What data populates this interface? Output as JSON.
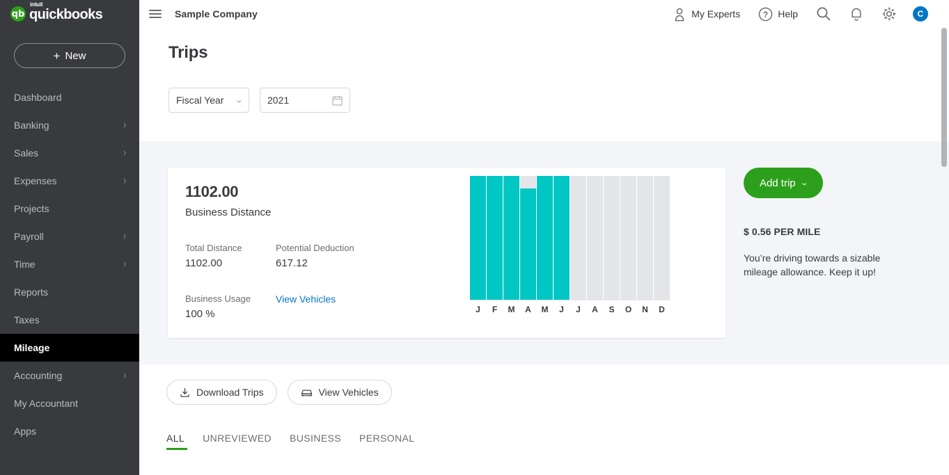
{
  "brand": {
    "intuit": "intuit",
    "name": "quickbooks",
    "mark": "qb",
    "green": "#2ca01c",
    "teal": "#00c7c4",
    "link_blue": "#0077c5"
  },
  "sidebar": {
    "new_button": "New",
    "new_plus": "+",
    "items": [
      {
        "label": "Dashboard",
        "expandable": false,
        "active": false
      },
      {
        "label": "Banking",
        "expandable": true,
        "active": false
      },
      {
        "label": "Sales",
        "expandable": true,
        "active": false
      },
      {
        "label": "Expenses",
        "expandable": true,
        "active": false
      },
      {
        "label": "Projects",
        "expandable": false,
        "active": false
      },
      {
        "label": "Payroll",
        "expandable": true,
        "active": false
      },
      {
        "label": "Time",
        "expandable": true,
        "active": false
      },
      {
        "label": "Reports",
        "expandable": false,
        "active": false
      },
      {
        "label": "Taxes",
        "expandable": false,
        "active": false
      },
      {
        "label": "Mileage",
        "expandable": false,
        "active": true
      },
      {
        "label": "Accounting",
        "expandable": true,
        "active": false
      },
      {
        "label": "My Accountant",
        "expandable": false,
        "active": false
      },
      {
        "label": "Apps",
        "expandable": false,
        "active": false
      }
    ]
  },
  "topbar": {
    "menu_icon": "hamburger-icon",
    "company": "Sample Company",
    "my_experts": "My Experts",
    "my_experts_icon": "person-icon",
    "help": "Help",
    "help_icon": "question-circle-icon",
    "search_icon": "search-icon",
    "notifications_icon": "bell-icon",
    "settings_icon": "gear-icon",
    "avatar_initial": "C"
  },
  "page": {
    "title": "Trips"
  },
  "filters": {
    "period": "Fiscal Year",
    "period_caret": "chevron-down-icon",
    "year": "2021",
    "year_icon": "calendar-icon"
  },
  "summary": {
    "headline_value": "1102.00",
    "headline_label": "Business Distance",
    "total_distance_label": "Total Distance",
    "total_distance_value": "1102.00",
    "potential_deduction_label": "Potential Deduction",
    "potential_deduction_value": "617.12",
    "business_usage_label": "Business Usage",
    "business_usage_value": "100 %",
    "view_vehicles_link": "View Vehicles"
  },
  "right_pane": {
    "add_trip": "Add trip",
    "add_trip_caret": "chevron-down-icon",
    "rate": "$ 0.56 PER MILE",
    "blurb": "You’re driving towards a sizable mileage allowance. Keep it up!"
  },
  "actions": {
    "download_trips": "Download Trips",
    "download_icon": "download-icon",
    "view_vehicles": "View Vehicles",
    "vehicle_icon": "car-icon"
  },
  "tabs": [
    {
      "label": "ALL",
      "active": true
    },
    {
      "label": "UNREVIEWED",
      "active": false
    },
    {
      "label": "BUSINESS",
      "active": false
    },
    {
      "label": "PERSONAL",
      "active": false
    }
  ],
  "chart_data": {
    "type": "bar",
    "title": "",
    "xlabel": "",
    "ylabel": "",
    "categories": [
      "J",
      "F",
      "M",
      "A",
      "M",
      "J",
      "J",
      "A",
      "S",
      "O",
      "N",
      "D"
    ],
    "category_names": [
      "January",
      "February",
      "March",
      "April",
      "May",
      "June",
      "July",
      "August",
      "September",
      "October",
      "November",
      "December"
    ],
    "track_height_pct": [
      100,
      100,
      100,
      100,
      100,
      100,
      100,
      100,
      100,
      100,
      100,
      100
    ],
    "values_pct": [
      100,
      100,
      100,
      90,
      100,
      100,
      0,
      0,
      0,
      0,
      0,
      0
    ],
    "filled_color": "#00c7c4",
    "track_color": "#e3e5e8",
    "grid": false,
    "legend": null,
    "ylim": [
      0,
      100
    ]
  }
}
